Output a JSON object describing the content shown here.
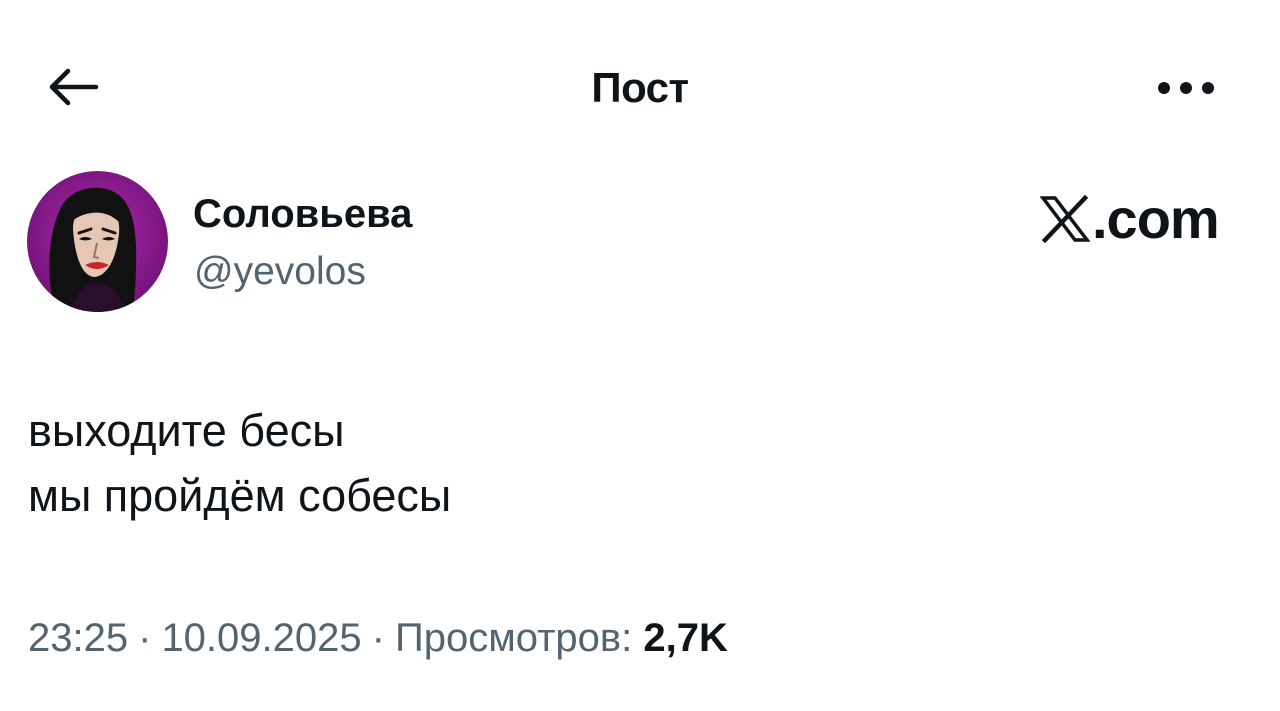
{
  "header": {
    "title": "Пост",
    "back_icon": "arrow-left-icon",
    "more_icon": "more-horizontal-icon"
  },
  "author": {
    "display_name": "Соловьева",
    "handle": "@yevolos",
    "avatar_accent": "#8b1a8f"
  },
  "brand": {
    "icon": "x-logo-icon",
    "text": ".com"
  },
  "post": {
    "lines": [
      "выходите бесы",
      "мы пройдём собесы"
    ]
  },
  "meta": {
    "time": "23:25",
    "separator": "·",
    "date": "10.09.2025",
    "views_label": "Просмотров:",
    "views_count": "2,7K"
  },
  "colors": {
    "text": "#0f1419",
    "secondary_text": "#536471",
    "background": "#ffffff"
  }
}
